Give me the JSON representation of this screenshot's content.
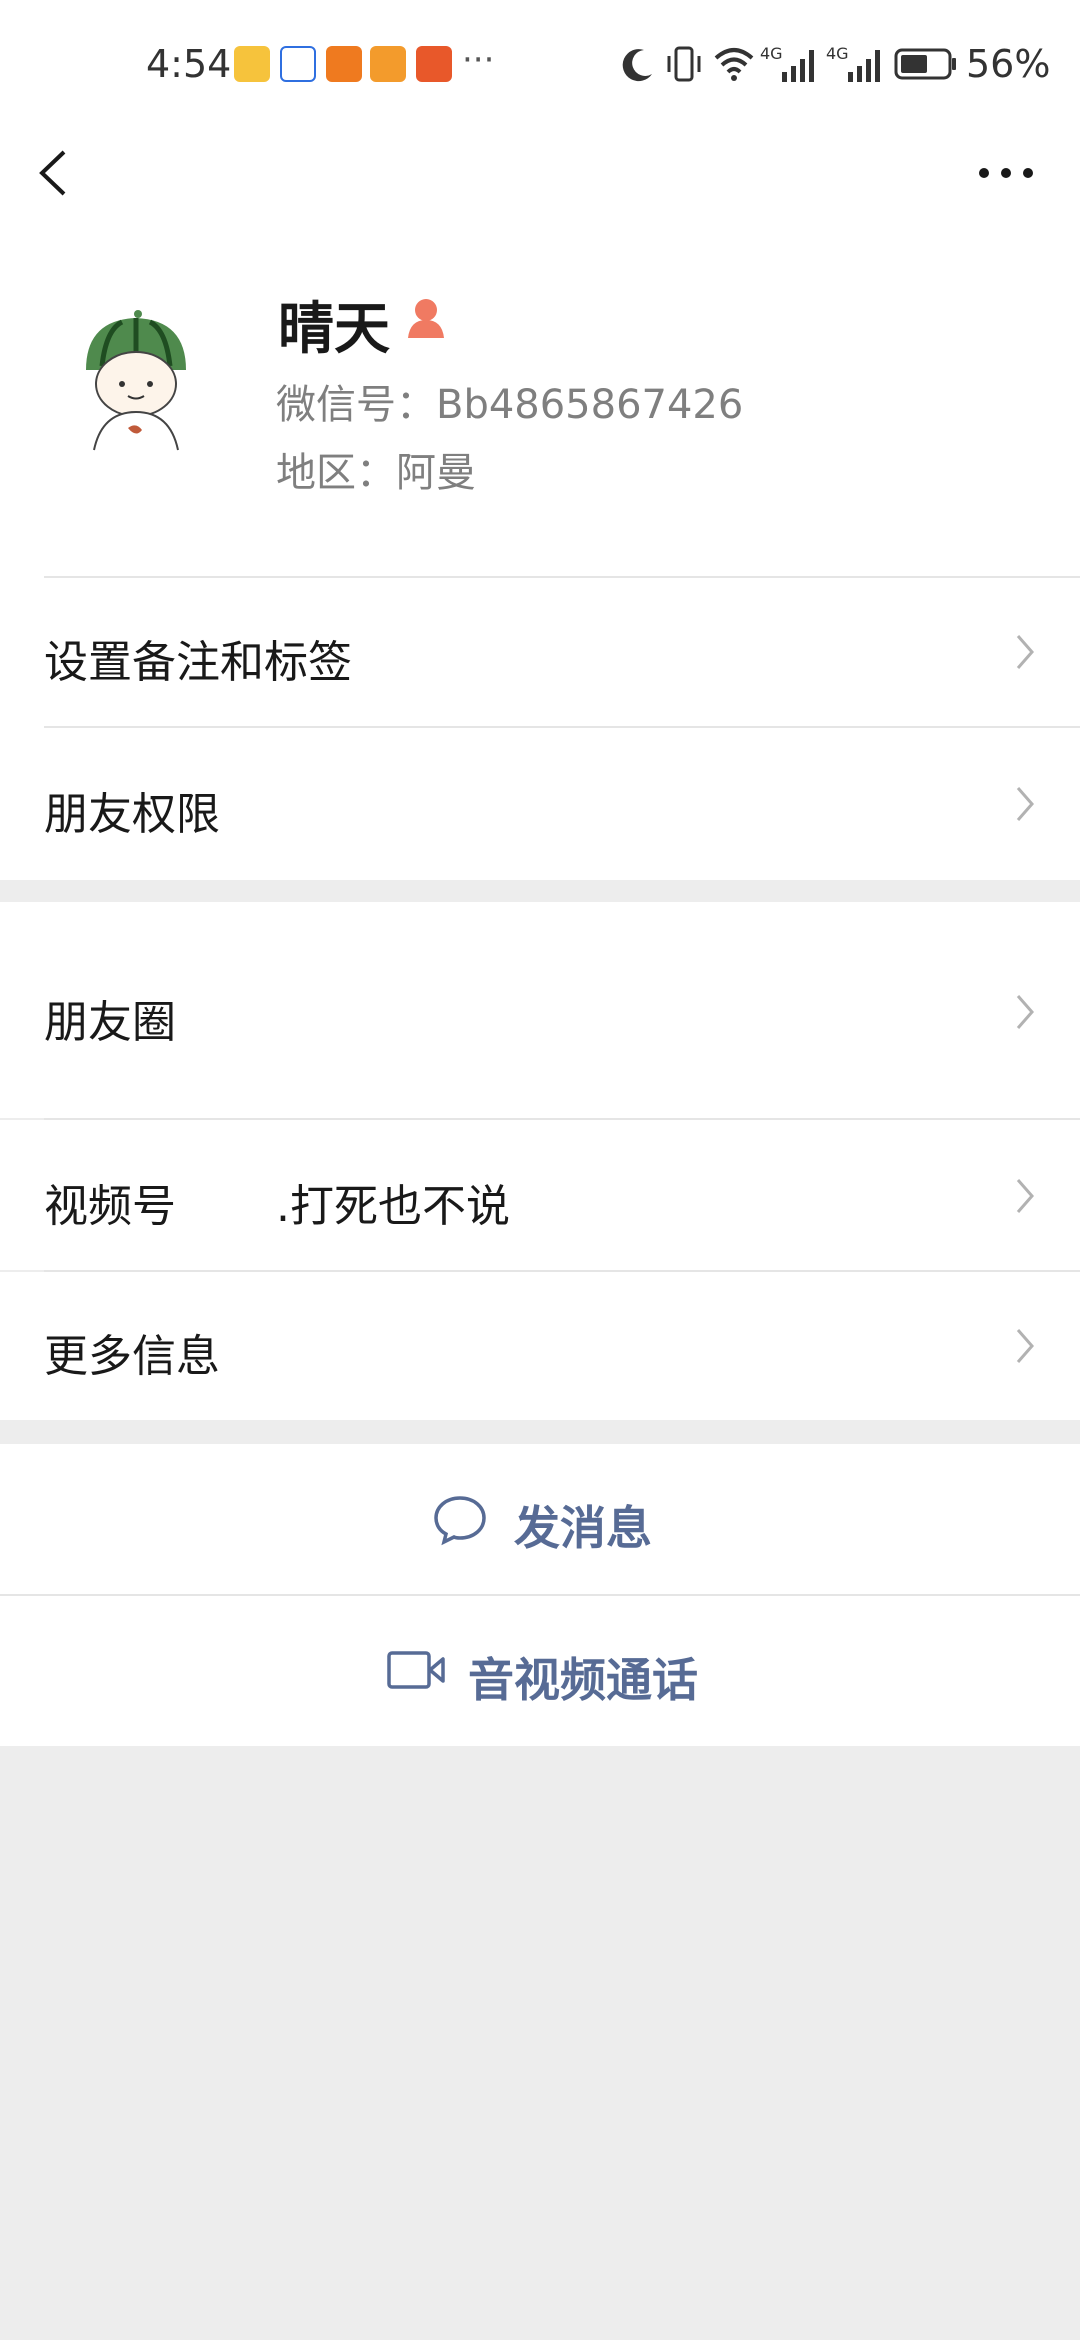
{
  "status_bar": {
    "time": "4:54",
    "more_dots": "···",
    "network1": "4G",
    "network2": "4G",
    "battery": "56%",
    "apps": [
      "weibo-icon",
      "baidu-icon",
      "app-orange-icon",
      "video-app-icon",
      "taobao-icon"
    ],
    "app_colors": [
      "#f6c33c",
      "#2f6fe0",
      "#ef7a1f",
      "#f39b2c",
      "#e8582a"
    ]
  },
  "profile": {
    "name": "晴天",
    "wechat_id": "微信号：Bb4865867426",
    "region": "地区：阿曼",
    "gender_color": "#f07a62"
  },
  "menu": {
    "remark": "设置备注和标签",
    "permission": "朋友权限",
    "moments": "朋友圈",
    "channels": "视频号",
    "channels_value": ".打死也不说",
    "more_info": "更多信息"
  },
  "actions": {
    "message": "发消息",
    "call": "音视频通话",
    "link_color": "#576b95"
  }
}
